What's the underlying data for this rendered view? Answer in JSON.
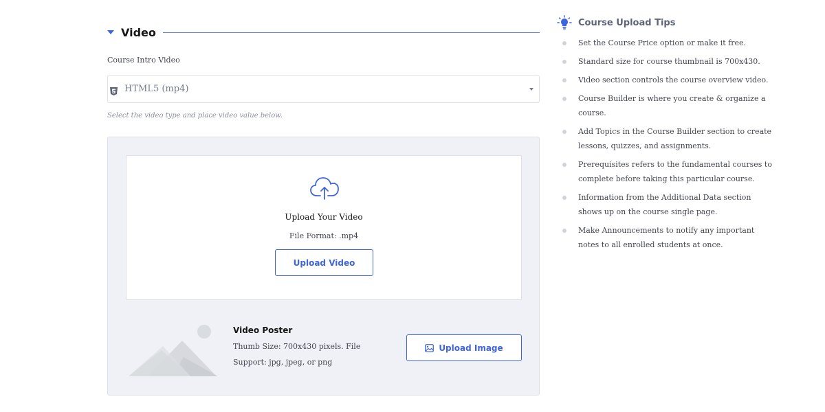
{
  "section": {
    "title": "Video"
  },
  "intro_video": {
    "label": "Course Intro Video",
    "selected": "HTML5 (mp4)",
    "hint": "Select the video type and place video value below."
  },
  "dropzone": {
    "title": "Upload Your Video",
    "format": "File Format: .mp4",
    "button": "Upload Video"
  },
  "poster": {
    "title": "Video Poster",
    "desc": "Thumb Size: 700x430 pixels. File Support: jpg, jpeg, or png",
    "button": "Upload Image"
  },
  "tips": {
    "title": "Course Upload Tips",
    "items": [
      "Set the Course Price option or make it free.",
      "Standard size for course thumbnail is 700x430.",
      "Video section controls the course overview video.",
      "Course Builder is where you create & organize a course.",
      "Add Topics in the Course Builder section to create lessons, quizzes, and assignments.",
      "Prerequisites refers to the fundamental courses to complete before taking this particular course.",
      "Information from the Additional Data section shows up on the course single page.",
      "Make Announcements to notify any important notes to all enrolled students at once."
    ]
  },
  "colors": {
    "accent": "#3e64de",
    "panel_bg": "#eff1f6",
    "border": "#dcdfe5"
  }
}
